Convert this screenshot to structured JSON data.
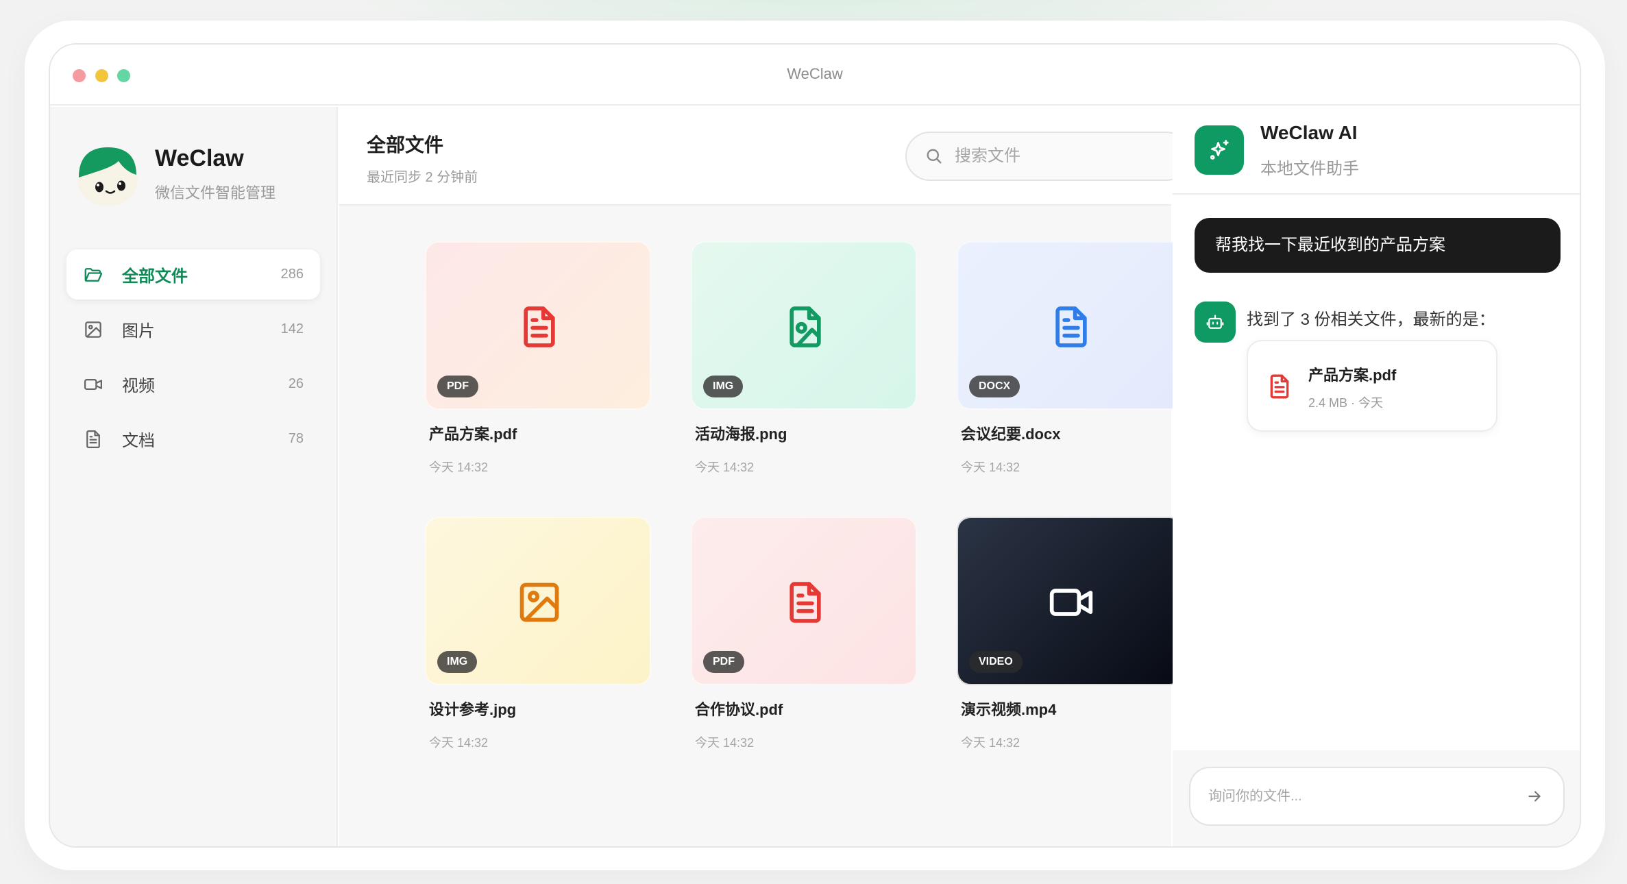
{
  "window": {
    "title": "WeClaw"
  },
  "brand": {
    "name": "WeClaw",
    "subtitle": "微信文件智能管理"
  },
  "sidebar": {
    "items": [
      {
        "label": "全部文件",
        "count": "286",
        "icon": "folder-icon",
        "active": true
      },
      {
        "label": "图片",
        "count": "142",
        "icon": "image-icon",
        "active": false
      },
      {
        "label": "视频",
        "count": "26",
        "icon": "video-icon",
        "active": false
      },
      {
        "label": "文档",
        "count": "78",
        "icon": "document-icon",
        "active": false
      }
    ]
  },
  "main": {
    "title": "全部文件",
    "sync_status": "最近同步 2 分钟前",
    "search_placeholder": "搜索文件",
    "files": [
      {
        "name": "产品方案.pdf",
        "date": "今天 14:32",
        "badge": "PDF",
        "icon": "pdf-file-icon"
      },
      {
        "name": "活动海报.png",
        "date": "今天 14:32",
        "badge": "IMG",
        "icon": "image-file-icon"
      },
      {
        "name": "会议纪要.docx",
        "date": "今天 14:32",
        "badge": "DOCX",
        "icon": "doc-file-icon"
      },
      {
        "name": "设计参考.jpg",
        "date": "今天 14:32",
        "badge": "IMG",
        "icon": "image-icon"
      },
      {
        "name": "合作协议.pdf",
        "date": "今天 14:32",
        "badge": "PDF",
        "icon": "pdf-file-icon"
      },
      {
        "name": "演示视频.mp4",
        "date": "今天 14:32",
        "badge": "VIDEO",
        "icon": "video-icon"
      }
    ]
  },
  "assistant": {
    "name": "WeClaw AI",
    "subtitle": "本地文件助手",
    "user_message": "帮我找一下最近收到的产品方案",
    "bot_message": "找到了 3 份相关文件，最新的是：",
    "result_file": {
      "name": "产品方案.pdf",
      "meta": "2.4 MB · 今天"
    },
    "input_placeholder": "询问你的文件..."
  },
  "colors": {
    "accent": "#0e9a62",
    "pdf_red": "#e53935",
    "image_green": "#129a63",
    "doc_blue": "#2f7de8",
    "image_orange": "#e07a0e"
  }
}
